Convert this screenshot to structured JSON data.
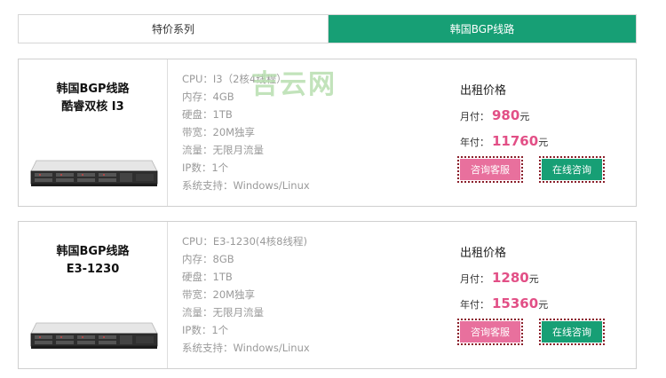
{
  "tabs": [
    {
      "label": "特价系列"
    },
    {
      "label": "韩国BGP线路"
    }
  ],
  "watermark": "吉云网",
  "cards": [
    {
      "name_line1": "韩国BGP线路",
      "name_line2": "酷睿双核 I3",
      "specs": [
        "CPU：I3（2核4线程）",
        "内存：4GB",
        "硬盘：1TB",
        "带宽：20M独享",
        "流量：无限月流量",
        "IP数：1个",
        "系统支持：Windows/Linux"
      ],
      "price_title": "出租价格",
      "monthly_label": "月付：",
      "monthly_value": "980",
      "yearly_label": "年付：",
      "yearly_value": "11760",
      "unit": "元",
      "service_button": "咨询客服",
      "online_button": "在线咨询"
    },
    {
      "name_line1": "韩国BGP线路",
      "name_line2": "E3-1230",
      "specs": [
        "CPU：E3-1230(4核8线程)",
        "内存：8GB",
        "硬盘：1TB",
        "带宽：20M独享",
        "流量：无限月流量",
        "IP数：1个",
        "系统支持：Windows/Linux"
      ],
      "price_title": "出租价格",
      "monthly_label": "月付：",
      "monthly_value": "1280",
      "yearly_label": "年付：",
      "yearly_value": "15360",
      "unit": "元",
      "service_button": "咨询客服",
      "online_button": "在线咨询"
    }
  ],
  "colors": {
    "accent_green": "#179f75",
    "price_pink": "#e24f86",
    "service_button_pink": "#e8709d"
  }
}
